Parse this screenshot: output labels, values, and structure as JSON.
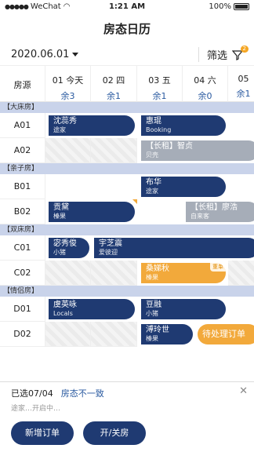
{
  "status": {
    "carrier": "WeChat",
    "time": "1:21 AM",
    "battery": "100%"
  },
  "title": "房态日历",
  "filter": {
    "date": "2020.06.01",
    "label": "筛选",
    "badge": "2"
  },
  "header": {
    "room_label": "房源",
    "days": [
      {
        "day": "01 今天",
        "left": "余3"
      },
      {
        "day": "02 四",
        "left": "余1"
      },
      {
        "day": "03 五",
        "left": "余1"
      },
      {
        "day": "04 六",
        "left": "余0"
      },
      {
        "day": "05",
        "left": "余1"
      }
    ]
  },
  "groups": [
    "【大床房】",
    "【亲子房】",
    "【双床房】",
    "【情侣房】"
  ],
  "rooms": [
    "A01",
    "A02",
    "B01",
    "B02",
    "C01",
    "C02",
    "D01",
    "D02"
  ],
  "bookings": [
    {
      "name": "沈蕊秀",
      "src": "途家"
    },
    {
      "name": "惠琨",
      "src": "Booking"
    },
    {
      "name": "【长租】智贞",
      "src": "贝壳"
    },
    {
      "name": "布华",
      "src": "途家"
    },
    {
      "name": "贡黛",
      "src": "榛果"
    },
    {
      "name": "【长租】廖浩",
      "src": "自来客"
    },
    {
      "name": "宓秀俊",
      "src": "小猪"
    },
    {
      "name": "宇芝震",
      "src": "爱彼迎"
    },
    {
      "name": "桑娣秋",
      "src": "榛果",
      "tag": "重单"
    },
    {
      "name": "虞英咏",
      "src": "Locals"
    },
    {
      "name": "豆融",
      "src": "小猪"
    },
    {
      "name": "溥玲世",
      "src": "榛果"
    }
  ],
  "pending": "待处理订单",
  "bottom": {
    "selected": "已选07/04",
    "warning": "房态不一致",
    "hint": "途家…开启中…",
    "btn1": "新增订单",
    "btn2": "开/关房",
    "close": "✕"
  },
  "colors": {
    "navy": "#1f3a72",
    "grey": "#a6adb8",
    "orange": "#f2a93b",
    "group": "#c9d3ea"
  }
}
